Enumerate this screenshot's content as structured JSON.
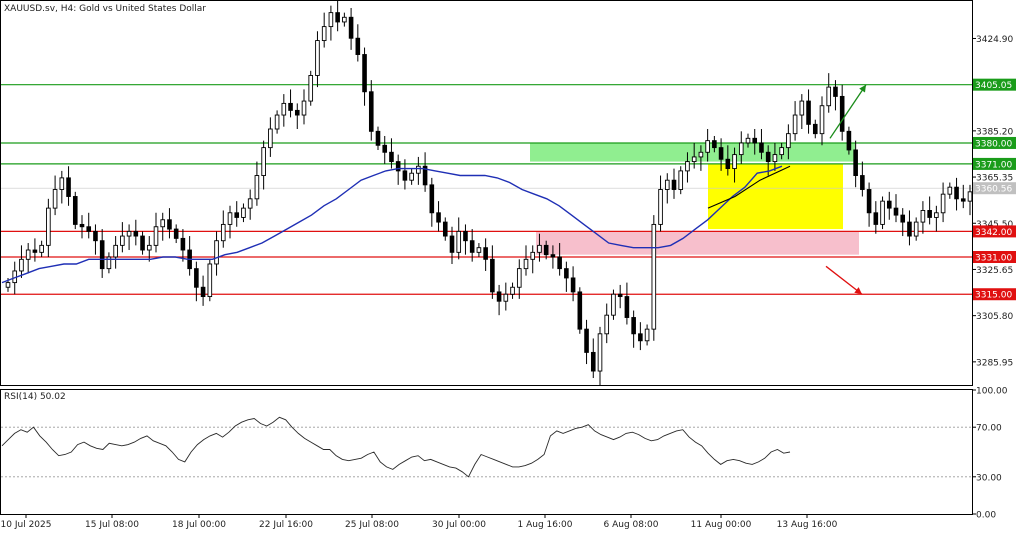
{
  "title": "XAUUSD.sv, H4:  Gold vs United States Dollar",
  "rsi_label": "RSI(14) 50.02",
  "chart_data": {
    "type": "candlestick",
    "symbol": "XAUUSD.sv",
    "timeframe": "H4",
    "price_range": [
      3276,
      3441
    ],
    "price_ticks": [
      "3424.90",
      "3385.20",
      "3365.35",
      "3345.50",
      "3325.65",
      "3305.80",
      "3285.95"
    ],
    "current_price": "3360.56",
    "x_labels": [
      "10 Jul 2025",
      "15 Jul 08:00",
      "18 Jul 00:00",
      "22 Jul 16:00",
      "25 Jul 08:00",
      "30 Jul 00:00",
      "1 Aug 16:00",
      "6 Aug 08:00",
      "11 Aug 00:00",
      "13 Aug 16:00"
    ],
    "levels": [
      {
        "price": 3405.05,
        "label": "3405.05",
        "color": "#1a9c1a"
      },
      {
        "price": 3380.0,
        "label": "3380.00",
        "color": "#1a9c1a"
      },
      {
        "price": 3371.0,
        "label": "3371.00",
        "color": "#1a9c1a"
      },
      {
        "price": 3342.0,
        "label": "3342.00",
        "color": "#e01010"
      },
      {
        "price": 3331.0,
        "label": "3331.00",
        "color": "#e01010"
      },
      {
        "price": 3315.0,
        "label": "3315.00",
        "color": "#e01010"
      }
    ],
    "zones": [
      {
        "name": "resistance",
        "p1": 3380.0,
        "p2": 3372.0,
        "color": "#90ee90"
      },
      {
        "name": "support",
        "p1": 3342.0,
        "p2": 3332.0,
        "color": "#f7bfcc"
      },
      {
        "name": "consolidation",
        "p1": 3371.0,
        "p2": 3343.0,
        "color": "#ffff00"
      }
    ],
    "closes": [
      3320,
      3325,
      3330,
      3334,
      3333,
      3336,
      3352,
      3360,
      3365,
      3357,
      3345,
      3344,
      3342,
      3338,
      3326,
      3331,
      3336,
      3340,
      3342,
      3340,
      3334,
      3336,
      3344,
      3347,
      3343,
      3339,
      3334,
      3326,
      3318,
      3314,
      3328,
      3338,
      3345,
      3350,
      3348,
      3352,
      3356,
      3366,
      3378,
      3386,
      3392,
      3397,
      3394,
      3392,
      3398,
      3409,
      3424,
      3430,
      3436,
      3432,
      3434,
      3425,
      3418,
      3402,
      3385,
      3379,
      3376,
      3372,
      3368,
      3364,
      3367,
      3370,
      3362,
      3350,
      3346,
      3340,
      3333,
      3342,
      3338,
      3333,
      3335,
      3330,
      3316,
      3312,
      3315,
      3318,
      3326,
      3330,
      3333,
      3336,
      3332,
      3331,
      3326,
      3322,
      3316,
      3300,
      3290,
      3282,
      3298,
      3306,
      3315,
      3314,
      3305,
      3298,
      3295,
      3300,
      3345,
      3360,
      3364,
      3360,
      3368,
      3372,
      3374,
      3376,
      3381,
      3378,
      3373,
      3369,
      3375,
      3380,
      3382,
      3380,
      3376,
      3372,
      3375,
      3378,
      3384,
      3392,
      3398,
      3388,
      3384,
      3396,
      3404,
      3400,
      3385,
      3377,
      3366,
      3360,
      3350,
      3345,
      3355,
      3352,
      3349,
      3346,
      3340,
      3346,
      3351,
      3348,
      3350,
      3358,
      3361,
      3356,
      3355,
      3359
    ],
    "ma_values": [
      3320,
      3322,
      3324,
      3326,
      3327,
      3328,
      3328,
      3330,
      3330,
      3330,
      3330,
      3330,
      3330,
      3331,
      3331,
      3330,
      3330,
      3330,
      3332,
      3333,
      3335,
      3337,
      3340,
      3343,
      3346,
      3349,
      3353,
      3356,
      3360,
      3364,
      3366,
      3368,
      3369,
      3369,
      3369,
      3368,
      3367,
      3366,
      3366,
      3366,
      3365,
      3363,
      3360,
      3358,
      3356,
      3353,
      3349,
      3345,
      3341,
      3337,
      3336,
      3335,
      3335,
      3335,
      3336,
      3339,
      3343,
      3347,
      3352,
      3357,
      3361,
      3367,
      3368,
      3370
    ],
    "rsi": {
      "range": [
        0,
        100
      ],
      "ticks": [
        "100.00",
        "70.00",
        "30.00",
        "0.00"
      ],
      "values": [
        55,
        60,
        65,
        68,
        66,
        70,
        63,
        58,
        52,
        47,
        48,
        50,
        56,
        58,
        55,
        53,
        52,
        57,
        56,
        55,
        56,
        58,
        61,
        63,
        59,
        57,
        55,
        50,
        44,
        42,
        50,
        56,
        60,
        63,
        65,
        62,
        66,
        71,
        74,
        76,
        77,
        73,
        71,
        74,
        78,
        76,
        70,
        65,
        61,
        58,
        55,
        52,
        52,
        47,
        44,
        43,
        44,
        45,
        48,
        50,
        42,
        38,
        36,
        40,
        43,
        46,
        47,
        43,
        44,
        42,
        40,
        38,
        37,
        34,
        30,
        40,
        48,
        46,
        44,
        42,
        40,
        38,
        38,
        39,
        41,
        44,
        48,
        63,
        67,
        65,
        67,
        69,
        70,
        72,
        67,
        64,
        62,
        60,
        62,
        65,
        66,
        64,
        61,
        59,
        60,
        63,
        65,
        67,
        68,
        62,
        58,
        55,
        49,
        44,
        40,
        43,
        44,
        43,
        41,
        40,
        42,
        45,
        50,
        52,
        49,
        50
      ]
    },
    "arrows": [
      {
        "direction": "up",
        "color": "#1a8c1a"
      },
      {
        "direction": "down",
        "color": "#e01010"
      }
    ]
  }
}
